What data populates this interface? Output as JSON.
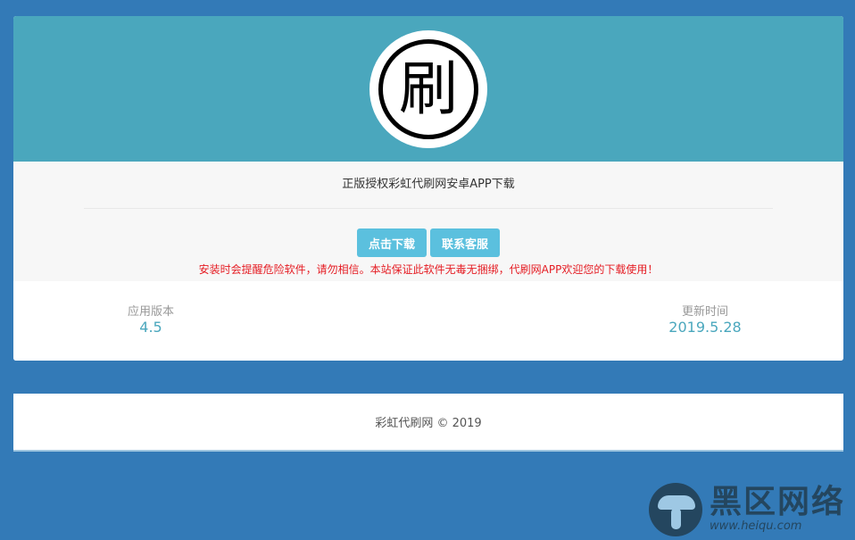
{
  "app": {
    "logo_char": "刷",
    "title": "正版授权彩虹代刷网安卓APP下载",
    "download_label": "点击下载",
    "contact_label": "联系客服",
    "warning": "安装时会提醒危险软件，请勿相信。本站保证此软件无毒无捆绑，代刷网APP欢迎您的下载使用！"
  },
  "info": {
    "version_label": "应用版本",
    "version_value": "4.5",
    "updated_label": "更新时间",
    "updated_value": "2019.5.28"
  },
  "footer": {
    "copyright": "彩虹代刷网 © 2019"
  },
  "watermark": {
    "title": "黑区网络",
    "url": "www.heiqu.com"
  },
  "colors": {
    "background": "#337ab7",
    "hero": "#4aa7bd",
    "button": "#5bc0de",
    "warning": "#e51c23"
  }
}
